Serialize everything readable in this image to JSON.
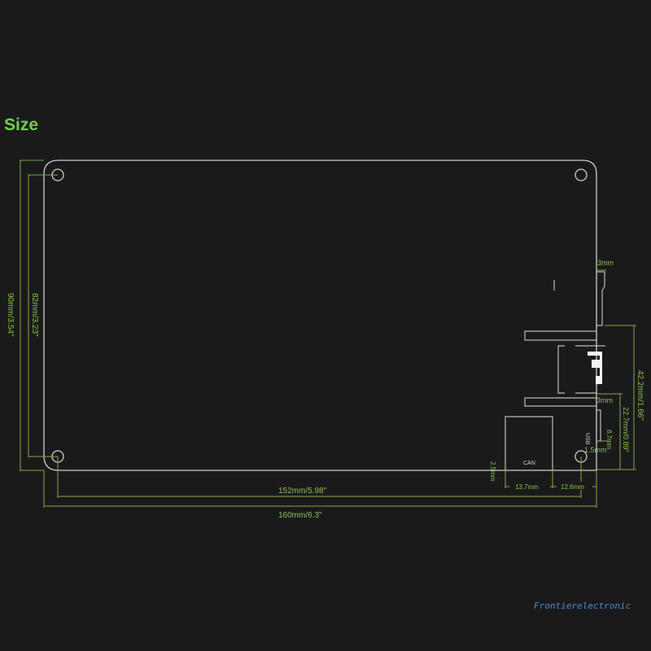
{
  "title": "Size",
  "watermark": "Frontierelectronic",
  "dimensions": {
    "height_outer": "90mm/3.54\"",
    "height_holes": "82mm/3.23\"",
    "width_holes": "152mm/5.98\"",
    "width_outer": "160mm/6.3\"",
    "top_offset": "3mm",
    "mid_offset": "3mm",
    "connector_height": "42.2mm/1.66\"",
    "usb_height": "22.7mm/0.89\"",
    "small_height": "8.7mm",
    "hole_offset": "1.5mm",
    "can_offset": "2.5mm",
    "can_width": "13.7mm",
    "can_to_edge": "12.6mm"
  },
  "labels": {
    "can": "CAN",
    "usb": "USB"
  },
  "colors": {
    "accent": "#6fd24a",
    "dimension": "#7fae45",
    "outline": "#cfcfcf"
  }
}
